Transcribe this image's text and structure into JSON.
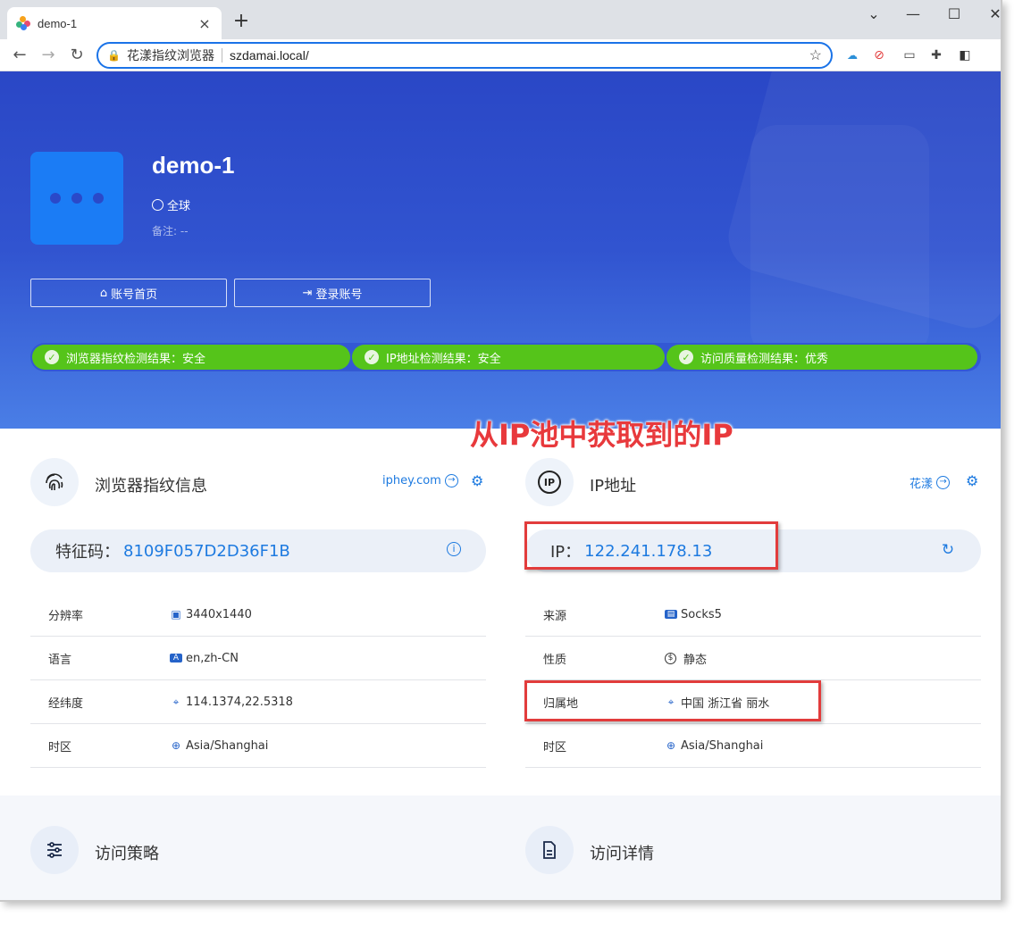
{
  "browser": {
    "tab_title": "demo-1",
    "new_tab": "+",
    "site_name": "花漾指纹浏览器",
    "url": "szdamai.local/"
  },
  "profile": {
    "name": "demo-1",
    "region": "全球",
    "remark": "备注: --",
    "btn_home": "账号首页",
    "btn_login": "登录账号"
  },
  "status": [
    {
      "label": "浏览器指纹检测结果：安全"
    },
    {
      "label": "IP地址检测结果：安全"
    },
    {
      "label": "访问质量检测结果：优秀"
    }
  ],
  "annotation": "从IP池中获取到的IP",
  "fingerprint": {
    "title": "浏览器指纹信息",
    "link": "iphey.com",
    "code_label": "特征码：",
    "code_value": "8109F057D2D36F1B",
    "rows": [
      {
        "key": "分辨率",
        "value": "3440x1440",
        "icon": "screen-icon"
      },
      {
        "key": "语言",
        "value": "en,zh-CN",
        "icon": "language-icon"
      },
      {
        "key": "经纬度",
        "value": "114.1374,22.5318",
        "icon": "location-pin-icon"
      },
      {
        "key": "时区",
        "value": "Asia/Shanghai",
        "icon": "globe-icon"
      }
    ]
  },
  "ip": {
    "title": "IP地址",
    "link": "花漾",
    "ip_label": "IP：",
    "ip_value": "122.241.178.13",
    "rows": [
      {
        "key": "来源",
        "value": "Socks5",
        "icon": "socks-icon"
      },
      {
        "key": "性质",
        "value": "静态",
        "icon": "dollar-icon"
      },
      {
        "key": "归属地",
        "value": "中国 浙江省 丽水",
        "icon": "location-pin-icon"
      },
      {
        "key": "时区",
        "value": "Asia/Shanghai",
        "icon": "globe-icon"
      }
    ]
  },
  "bottom": {
    "strategy": "访问策略",
    "details": "访问详情"
  },
  "colors": {
    "accent": "#1d7ae0",
    "hero": "#2a47c6",
    "success": "#55c41a",
    "annotation": "#e8393c"
  }
}
